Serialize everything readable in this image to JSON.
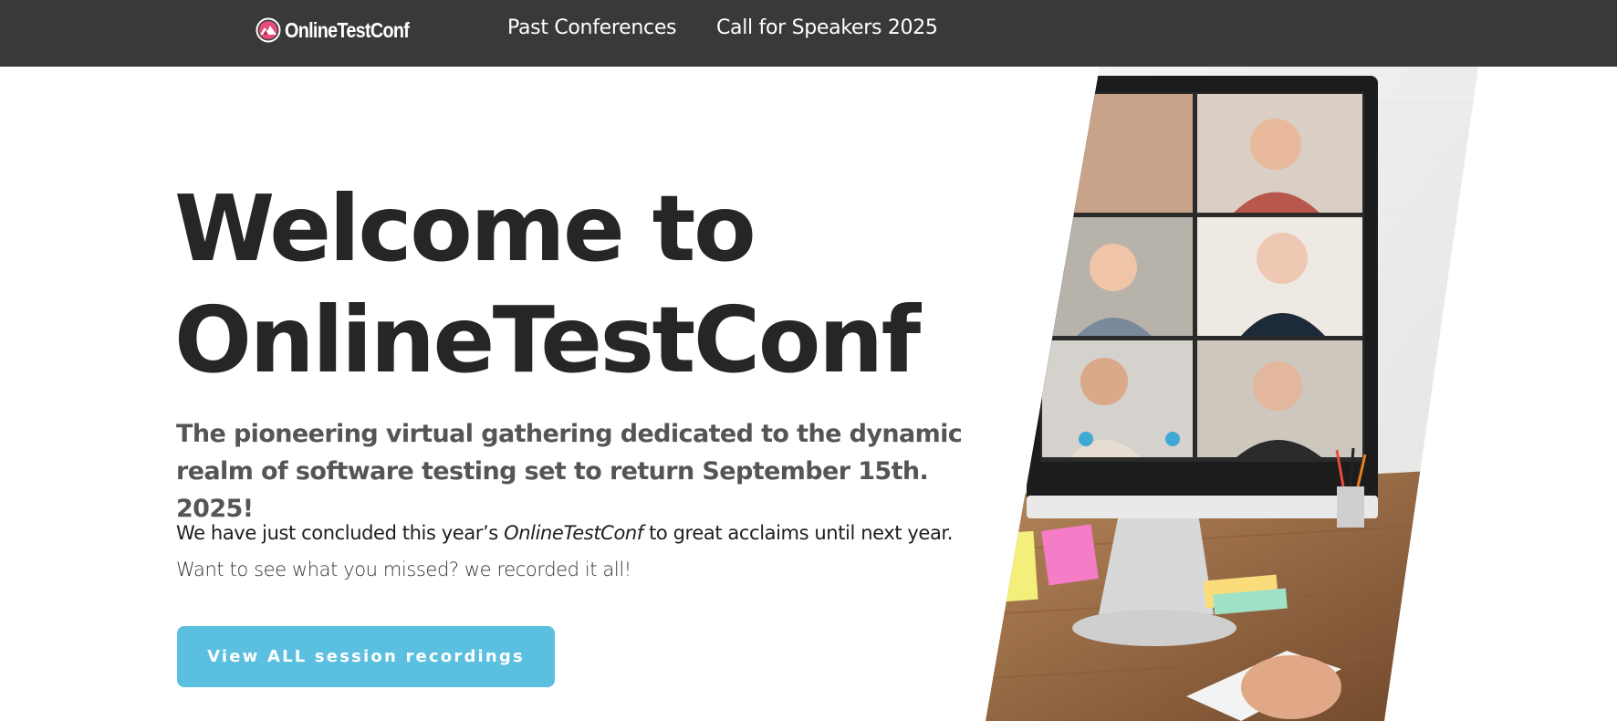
{
  "header": {
    "logo_text": "OnlineTestConf",
    "nav": [
      {
        "label": "Past Conferences"
      },
      {
        "label": "Call for Speakers 2025"
      }
    ]
  },
  "hero": {
    "title_line1": "Welcome to",
    "title_line2": "OnlineTestConf",
    "subtitle": "The pioneering virtual gathering dedicated to the dynamic realm of software testing set to return September 15th. 2025!",
    "body_part1": "We have just concluded this year’s ",
    "body_emphasis": "OnlineTestConf",
    "body_part2": " to great acclaims until next year.",
    "body_part3": " Want to see what you missed? we recorded it all!",
    "cta_label": "View ALL session recordings"
  },
  "colors": {
    "nav_background": "#393939",
    "accent": "#5bbfdf",
    "logo_mark": "#e44c7a",
    "title_text": "#262626",
    "subtitle_text": "#555555"
  },
  "icons": {
    "logo": "onlinetestconf-logo-icon",
    "photo": "video-call-desk-photo"
  }
}
